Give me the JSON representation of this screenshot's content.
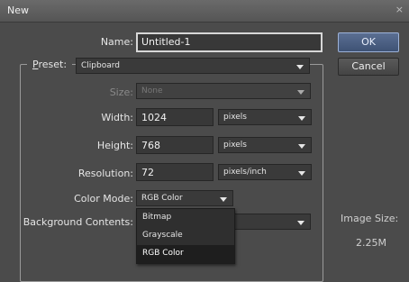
{
  "window": {
    "title": "New",
    "close_glyph": "×"
  },
  "name": {
    "label": "Name:",
    "value": "Untitled-1"
  },
  "preset": {
    "label_first": "P",
    "label_rest": "reset:",
    "value": "Clipboard"
  },
  "size": {
    "label": "Size:",
    "value": "None"
  },
  "width": {
    "label": "Width:",
    "value": "1024",
    "unit": "pixels"
  },
  "height": {
    "label": "Height:",
    "value": "768",
    "unit": "pixels"
  },
  "resolution": {
    "label": "Resolution:",
    "value": "72",
    "unit": "pixels/inch"
  },
  "color_mode": {
    "label": "Color Mode:",
    "value": "RGB Color",
    "options": [
      "Bitmap",
      "Grayscale",
      "RGB Color"
    ],
    "selected_index": 2
  },
  "background": {
    "label": "Background Contents:",
    "value": ""
  },
  "buttons": {
    "ok": "OK",
    "cancel": "Cancel"
  },
  "image_size": {
    "label": "Image Size:",
    "value": "2.25M"
  }
}
